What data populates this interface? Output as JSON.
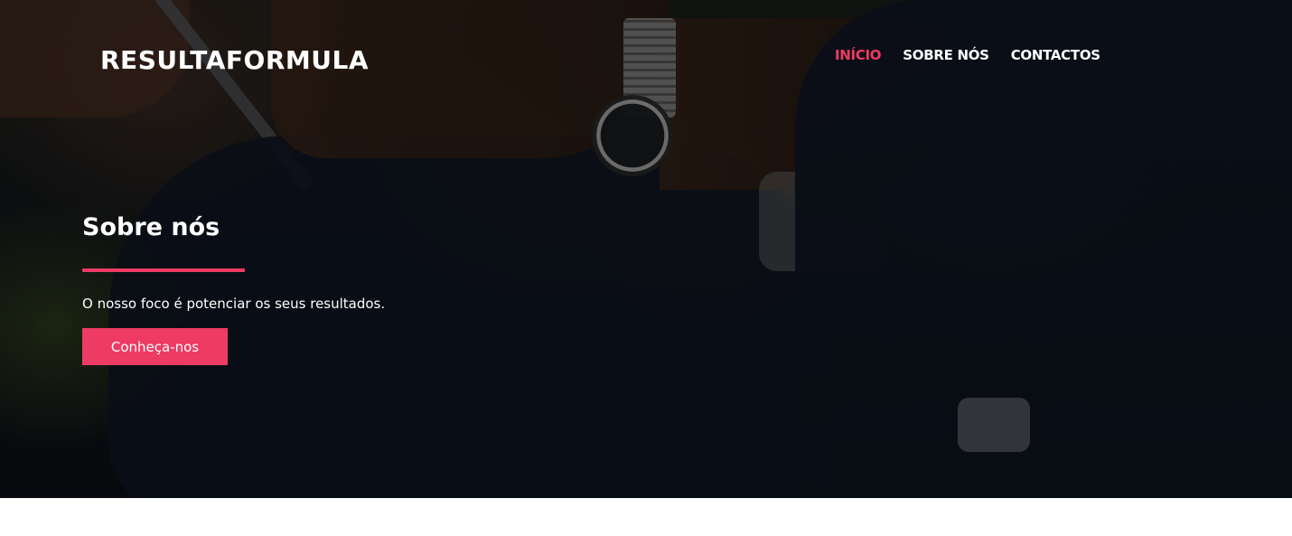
{
  "header": {
    "brand": "RESULTAFORMULA",
    "nav": [
      {
        "label": "INÍCIO",
        "active": true
      },
      {
        "label": "SOBRE NÓS",
        "active": false
      },
      {
        "label": "CONTACTOS",
        "active": false
      }
    ]
  },
  "hero": {
    "title": "Sobre nós",
    "subtitle": "O nosso foco é potenciar os seus resultados.",
    "cta_label": "Conheça-nos",
    "background_image": "hero-photo"
  },
  "colors": {
    "accent": "#ee3b64",
    "text": "#ffffff",
    "page_background": "#ffffff"
  }
}
